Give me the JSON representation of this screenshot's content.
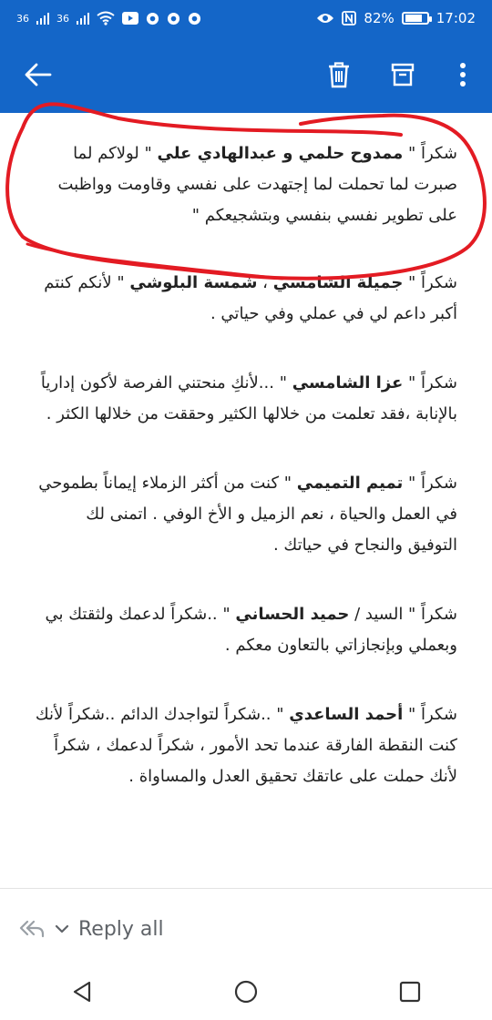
{
  "status": {
    "signal1": "36",
    "signal2": "36",
    "battery": "82%",
    "time": "17:02"
  },
  "icons": {
    "back": "arrow-left-icon",
    "delete": "trash-icon",
    "archive": "archive-icon",
    "more": "more-vertical-icon"
  },
  "message": {
    "p1": {
      "a": "شكراً \" ",
      "b": "ممدوح حلمي و عبدالهادي علي",
      "c": " \" لولاكم لما صبرت لما تحملت لما إجتهدت على نفسي وقاومت وواظبت على تطوير نفسي بنفسي وبتشجيعكم \""
    },
    "p2": {
      "a": "شكراً \" ",
      "b": "جميلة الشامسي",
      "c": " ، ",
      "d": "شمسة البلوشي",
      "e": " \" لأنكم كنتم أكبر داعم لي في عملي وفي حياتي ."
    },
    "p3": {
      "a": "شكراً \" ",
      "b": "عزا الشامسي",
      "c": " \" ...لأنكِ منحتني الفرصة لأكون إدارياً بالإنابة ،فقد تعلمت من خلالها الكثير وحققت من خلالها الكثر ."
    },
    "p4": {
      "a": "شكراً \" ",
      "b": "تميم التميمي",
      "c": " \" كنت من أكثر الزملاء إيماناً بطموحي في العمل والحياة ، نعم الزميل و الأخ الوفي . اتمنى لك التوفيق والنجاح في حياتك ."
    },
    "p5": {
      "a": "شكراً \" السيد / ",
      "b": "حميد الحساني",
      "c": " \" ..شكراً لدعمك ولثقتك بي وبعملي وبإنجازاتي بالتعاون معكم ."
    },
    "p6": {
      "a": "شكراً \" ",
      "b": "أحمد الساعدي",
      "c": " \" ..شكراً لتواجدك الدائم ..شكراً لأنك كنت النقطة الفارقة عندما تحد الأمور ، شكراً لدعمك ، شكراً لأنك حملت على عاتقك تحقيق العدل والمساواة ."
    }
  },
  "reply": {
    "label": "Reply all"
  },
  "colors": {
    "bar": "#1466c8",
    "annotation": "#e31b23",
    "text": "#222222"
  }
}
